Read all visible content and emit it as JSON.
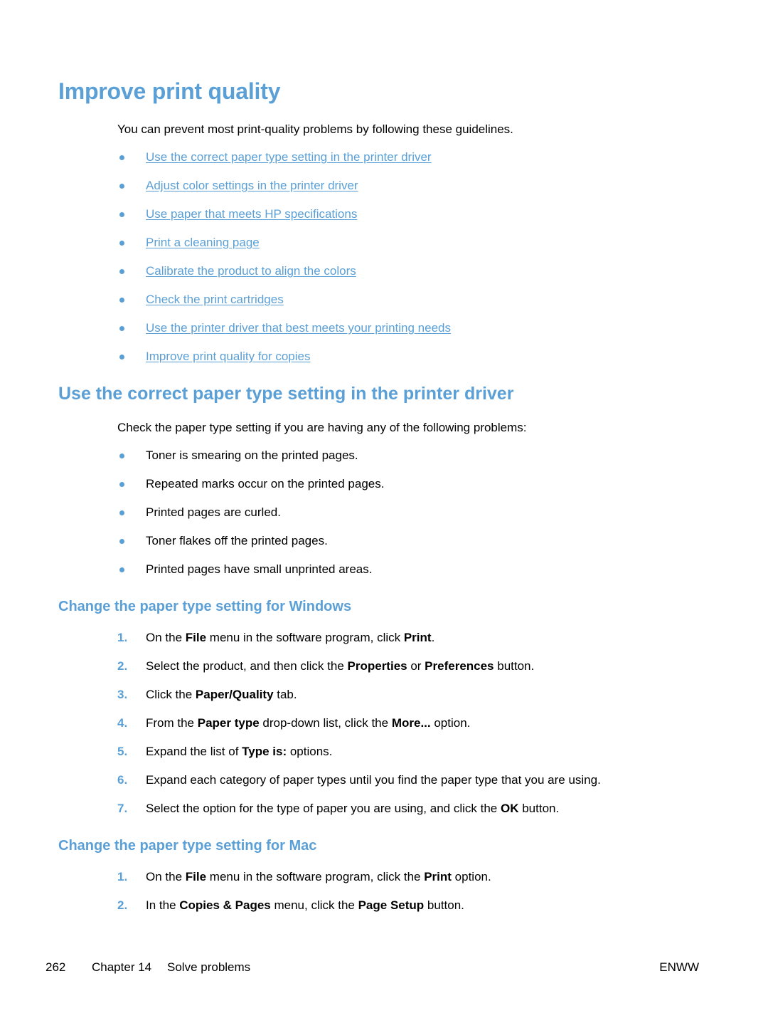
{
  "title": "Improve print quality",
  "intro": "You can prevent most print-quality problems by following these guidelines.",
  "guideline_links": [
    "Use the correct paper type setting in the printer driver",
    "Adjust color settings in the printer driver",
    "Use paper that meets HP specifications",
    "Print a cleaning page",
    "Calibrate the product to align the colors",
    "Check the print cartridges",
    "Use the printer driver that best meets your printing needs",
    "Improve print quality for copies"
  ],
  "section": {
    "heading": "Use the correct paper type setting in the printer driver",
    "intro": "Check the paper type setting if you are having any of the following problems:",
    "problems": [
      "Toner is smearing on the printed pages.",
      "Repeated marks occur on the printed pages.",
      "Printed pages are curled.",
      "Toner flakes off the printed pages.",
      "Printed pages have small unprinted areas."
    ]
  },
  "windows": {
    "heading": "Change the paper type setting for Windows",
    "steps": [
      {
        "num": "1.",
        "parts": [
          {
            "t": "On the "
          },
          {
            "t": "File",
            "b": true
          },
          {
            "t": " menu in the software program, click "
          },
          {
            "t": "Print",
            "b": true
          },
          {
            "t": "."
          }
        ]
      },
      {
        "num": "2.",
        "parts": [
          {
            "t": "Select the product, and then click the "
          },
          {
            "t": "Properties",
            "b": true
          },
          {
            "t": " or "
          },
          {
            "t": "Preferences",
            "b": true
          },
          {
            "t": " button."
          }
        ]
      },
      {
        "num": "3.",
        "parts": [
          {
            "t": "Click the "
          },
          {
            "t": "Paper/Quality",
            "b": true
          },
          {
            "t": " tab."
          }
        ]
      },
      {
        "num": "4.",
        "parts": [
          {
            "t": "From the "
          },
          {
            "t": "Paper type",
            "b": true
          },
          {
            "t": " drop-down list, click the "
          },
          {
            "t": "More...",
            "b": true
          },
          {
            "t": " option."
          }
        ]
      },
      {
        "num": "5.",
        "parts": [
          {
            "t": "Expand the list of "
          },
          {
            "t": "Type is:",
            "b": true
          },
          {
            "t": " options."
          }
        ]
      },
      {
        "num": "6.",
        "parts": [
          {
            "t": "Expand each category of paper types until you find the paper type that you are using."
          }
        ]
      },
      {
        "num": "7.",
        "parts": [
          {
            "t": "Select the option for the type of paper you are using, and click the "
          },
          {
            "t": "OK",
            "b": true
          },
          {
            "t": " button."
          }
        ]
      }
    ]
  },
  "mac": {
    "heading": "Change the paper type setting for Mac",
    "steps": [
      {
        "num": "1.",
        "parts": [
          {
            "t": "On the "
          },
          {
            "t": "File",
            "b": true
          },
          {
            "t": " menu in the software program, click the "
          },
          {
            "t": "Print",
            "b": true
          },
          {
            "t": " option."
          }
        ]
      },
      {
        "num": "2.",
        "parts": [
          {
            "t": "In the "
          },
          {
            "t": "Copies & Pages",
            "b": true
          },
          {
            "t": " menu, click the "
          },
          {
            "t": "Page Setup",
            "b": true
          },
          {
            "t": " button."
          }
        ]
      }
    ]
  },
  "footer": {
    "page_number": "262",
    "chapter": "Chapter 14",
    "chapter_title": "Solve problems",
    "locale": "ENWW"
  }
}
